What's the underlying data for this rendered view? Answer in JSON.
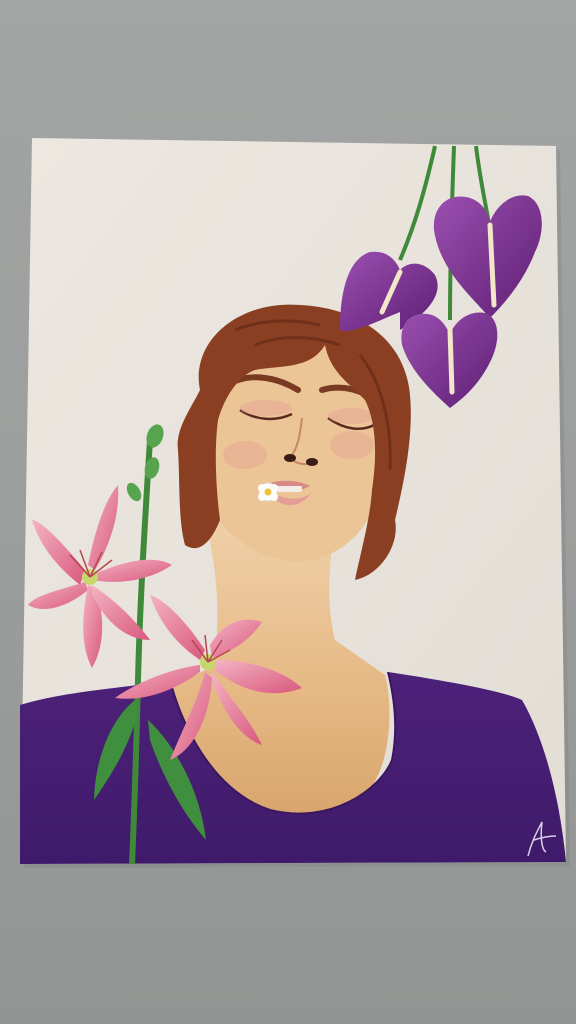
{
  "scene": {
    "subject": "colored-pencil-portrait-with-flowers",
    "colors": {
      "wall": "#9c9e9d",
      "paper": "#ebe7e1",
      "shirt": "#4b1f78",
      "skin": "#e8bf8a",
      "hair": "#8a3f22",
      "lily_petal": "#e9849f",
      "lily_light": "#f7c6d2",
      "anthurium": "#7a2f8f",
      "stem_green": "#3f8a3a"
    },
    "icons": [
      "lily-flower",
      "anthurium-flower",
      "daisy",
      "signature"
    ]
  }
}
